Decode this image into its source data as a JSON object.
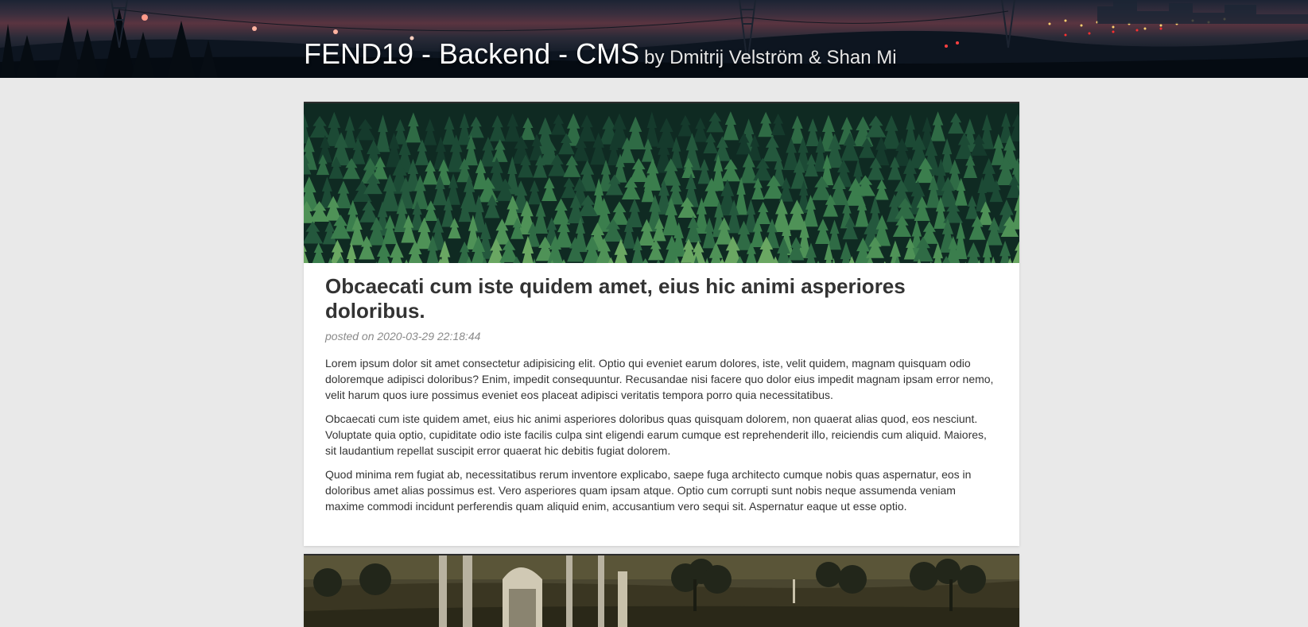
{
  "header": {
    "title": "FEND19 - Backend - CMS",
    "subtitle": "by Dmitrij Velström & Shan Mi",
    "banner_icon": "night-city-landscape-image"
  },
  "posts": [
    {
      "image_icon": "pine-forest-image",
      "title": "Obcaecati cum iste quidem amet, eius hic animi asperiores doloribus.",
      "meta": "posted on 2020-03-29 22:18:44",
      "paragraphs": [
        "Lorem ipsum dolor sit amet consectetur adipisicing elit. Optio qui eveniet earum dolores, iste, velit quidem, magnam quisquam odio doloremque adipisci doloribus? Enim, impedit consequuntur. Recusandae nisi facere quo dolor eius impedit magnam ipsam error nemo, velit harum quos iure possimus eveniet eos placeat adipisci veritatis tempora porro quia necessitatibus.",
        "Obcaecati cum iste quidem amet, eius hic animi asperiores doloribus quas quisquam dolorem, non quaerat alias quod, eos nesciunt. Voluptate quia optio, cupiditate odio iste facilis culpa sint eligendi earum cumque est reprehenderit illo, reiciendis cum aliquid. Maiores, sit laudantium repellat suscipit error quaerat hic debitis fugiat dolorem.",
        "Quod minima rem fugiat ab, necessitatibus rerum inventore explicabo, saepe fuga architecto cumque nobis quas aspernatur, eos in doloribus amet alias possimus est. Vero asperiores quam ipsam atque. Optio cum corrupti sunt nobis neque assumenda veniam maxime commodi incidunt perferendis quam aliquid enim, accusantium vero sequi sit. Aspernatur eaque ut esse optio."
      ]
    },
    {
      "image_icon": "ruins-landscape-image"
    }
  ]
}
